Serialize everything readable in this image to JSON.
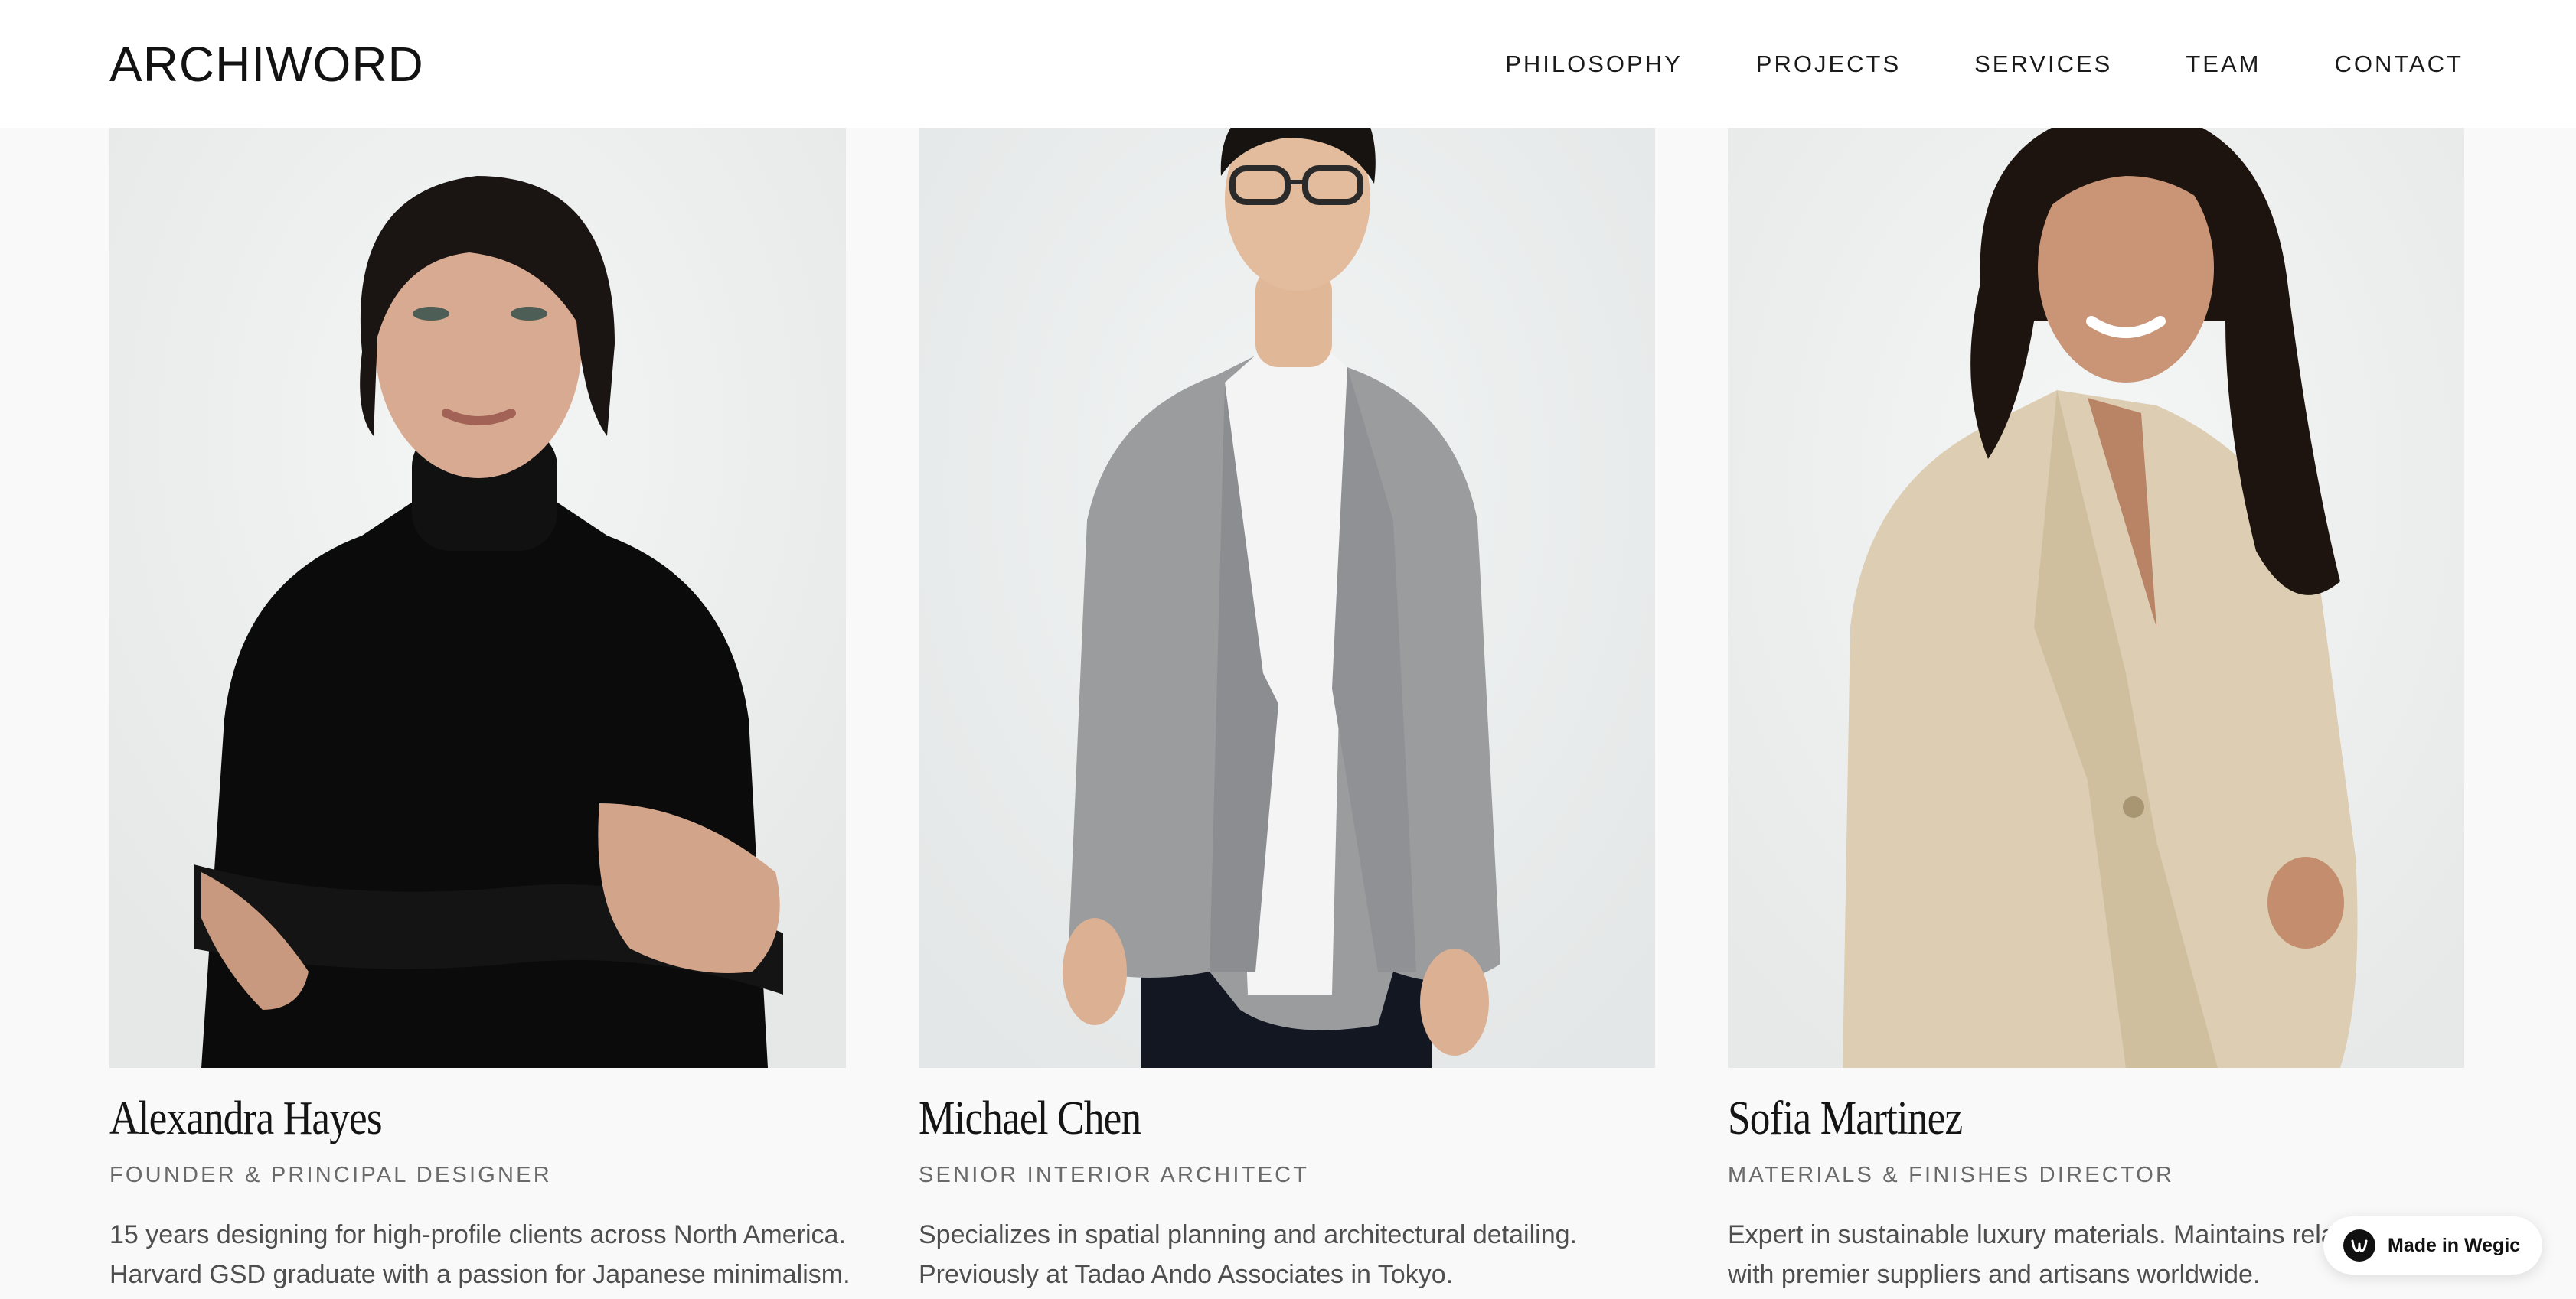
{
  "header": {
    "logo": "ARCHIWORD",
    "nav": [
      "PHILOSOPHY",
      "PROJECTS",
      "SERVICES",
      "TEAM",
      "CONTACT"
    ]
  },
  "team": [
    {
      "name": "Alexandra Hayes",
      "role": "FOUNDER & PRINCIPAL DESIGNER",
      "bio_lines": [
        "15 years designing for high-profile clients across North America.",
        "Harvard GSD graduate with a passion for Japanese minimalism."
      ],
      "photo_icon": "portrait-photo-black-turtleneck"
    },
    {
      "name": "Michael Chen",
      "role": "SENIOR INTERIOR ARCHITECT",
      "bio_lines": [
        "Specializes in spatial planning and architectural detailing.",
        "Previously at Tadao Ando Associates in Tokyo."
      ],
      "photo_icon": "portrait-photo-grey-blazer"
    },
    {
      "name": "Sofia Martinez",
      "role": "MATERIALS & FINISHES DIRECTOR",
      "bio_lines": [
        "Expert in sustainable luxury materials. Maintains relat",
        "with premier suppliers and artisans worldwide."
      ],
      "photo_icon": "portrait-photo-linen-blazer"
    }
  ],
  "badge": {
    "label": "Made in Wegic",
    "icon": "wegic-logo-icon"
  },
  "colors": {
    "page_background": "#f9f9f9",
    "header_background": "#ffffff",
    "text_primary": "#141414",
    "text_secondary": "#6a6a6a",
    "text_body": "#4e4e4e"
  }
}
